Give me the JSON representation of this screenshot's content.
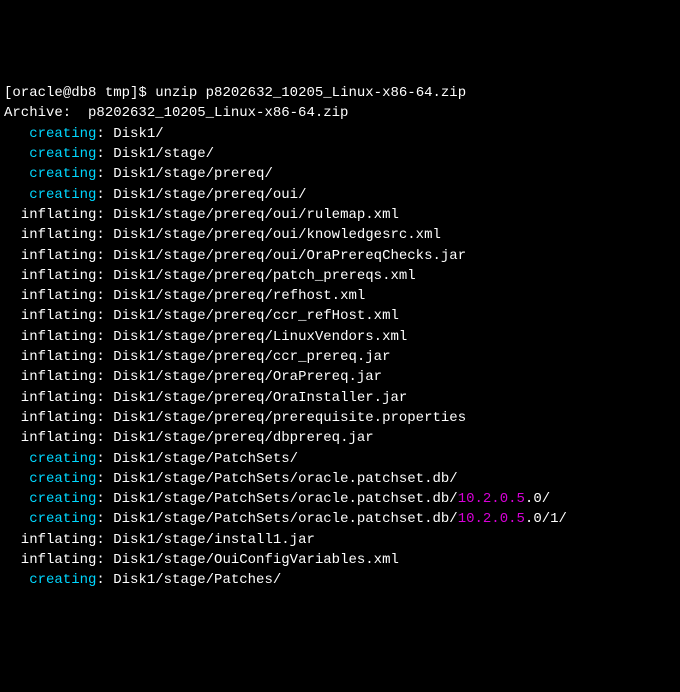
{
  "prompt": {
    "bracket_open": "[",
    "user_host": "oracle@db8 tmp",
    "bracket_close": "]$",
    "separator": " ",
    "command": "unzip p8202632_10205_Linux-x86-64.zip"
  },
  "archive_line": {
    "label": "Archive:  ",
    "file": "p8202632_10205_Linux-x86-64.zip"
  },
  "lines": [
    {
      "action": "   creating",
      "path": "Disk1/"
    },
    {
      "action": "   creating",
      "path": "Disk1/stage/"
    },
    {
      "action": "   creating",
      "path": "Disk1/stage/prereq/"
    },
    {
      "action": "   creating",
      "path": "Disk1/stage/prereq/oui/"
    },
    {
      "action": "  inflating",
      "path": "Disk1/stage/prereq/oui/rulemap.xml"
    },
    {
      "action": "  inflating",
      "path": "Disk1/stage/prereq/oui/knowledgesrc.xml"
    },
    {
      "action": "  inflating",
      "path": "Disk1/stage/prereq/oui/OraPrereqChecks.jar"
    },
    {
      "action": "  inflating",
      "path": "Disk1/stage/prereq/patch_prereqs.xml"
    },
    {
      "action": "  inflating",
      "path": "Disk1/stage/prereq/refhost.xml"
    },
    {
      "action": "  inflating",
      "path": "Disk1/stage/prereq/ccr_refHost.xml"
    },
    {
      "action": "  inflating",
      "path": "Disk1/stage/prereq/LinuxVendors.xml"
    },
    {
      "action": "  inflating",
      "path": "Disk1/stage/prereq/ccr_prereq.jar"
    },
    {
      "action": "  inflating",
      "path": "Disk1/stage/prereq/OraPrereq.jar"
    },
    {
      "action": "  inflating",
      "path": "Disk1/stage/prereq/OraInstaller.jar"
    },
    {
      "action": "  inflating",
      "path": "Disk1/stage/prereq/prerequisite.properties"
    },
    {
      "action": "  inflating",
      "path": "Disk1/stage/prereq/dbprereq.jar"
    },
    {
      "action": "   creating",
      "path": "Disk1/stage/PatchSets/"
    },
    {
      "action": "   creating",
      "path": "Disk1/stage/PatchSets/oracle.patchset.db/"
    },
    {
      "action": "   creating",
      "path_pre": "Disk1/stage/PatchSets/oracle.patchset.db/",
      "version": "10.2.0.5",
      "path_post": ".0/"
    },
    {
      "action": "   creating",
      "path_pre": "Disk1/stage/PatchSets/oracle.patchset.db/",
      "version": "10.2.0.5",
      "path_post": ".0/1/"
    },
    {
      "action": "  inflating",
      "path": "Disk1/stage/install1.jar"
    },
    {
      "action": "  inflating",
      "path": "Disk1/stage/OuiConfigVariables.xml"
    },
    {
      "action": "   creating",
      "path": "Disk1/stage/Patches/"
    }
  ]
}
